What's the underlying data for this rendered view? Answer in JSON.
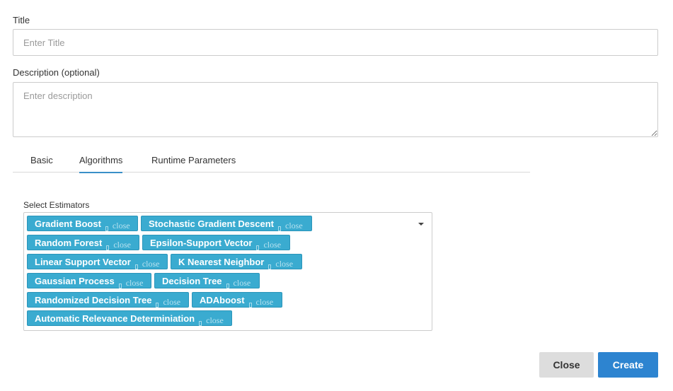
{
  "form": {
    "title_label": "Title",
    "title_placeholder": "Enter Title",
    "title_value": "",
    "description_label": "Description (optional)",
    "description_placeholder": "Enter description",
    "description_value": ""
  },
  "tabs": [
    {
      "label": "Basic",
      "active": false
    },
    {
      "label": "Algorithms",
      "active": true
    },
    {
      "label": "Runtime Parameters",
      "active": false
    }
  ],
  "estimators": {
    "label": "Select Estimators",
    "close_text": "close",
    "selected": [
      "Gradient Boost",
      "Stochastic Gradient Descent",
      "Random Forest",
      "Epsilon-Support Vector",
      "Linear Support Vector",
      "K Nearest Neighbor",
      "Gaussian Process",
      "Decision Tree",
      "Randomized Decision Tree",
      "ADAboost",
      "Automatic Relevance Determiniation"
    ]
  },
  "footer": {
    "close_label": "Close",
    "create_label": "Create"
  },
  "colors": {
    "chip_bg": "#3aabd0",
    "tab_active": "#3a8fc8",
    "primary_button": "#2d84d0",
    "secondary_button": "#dddddd"
  }
}
